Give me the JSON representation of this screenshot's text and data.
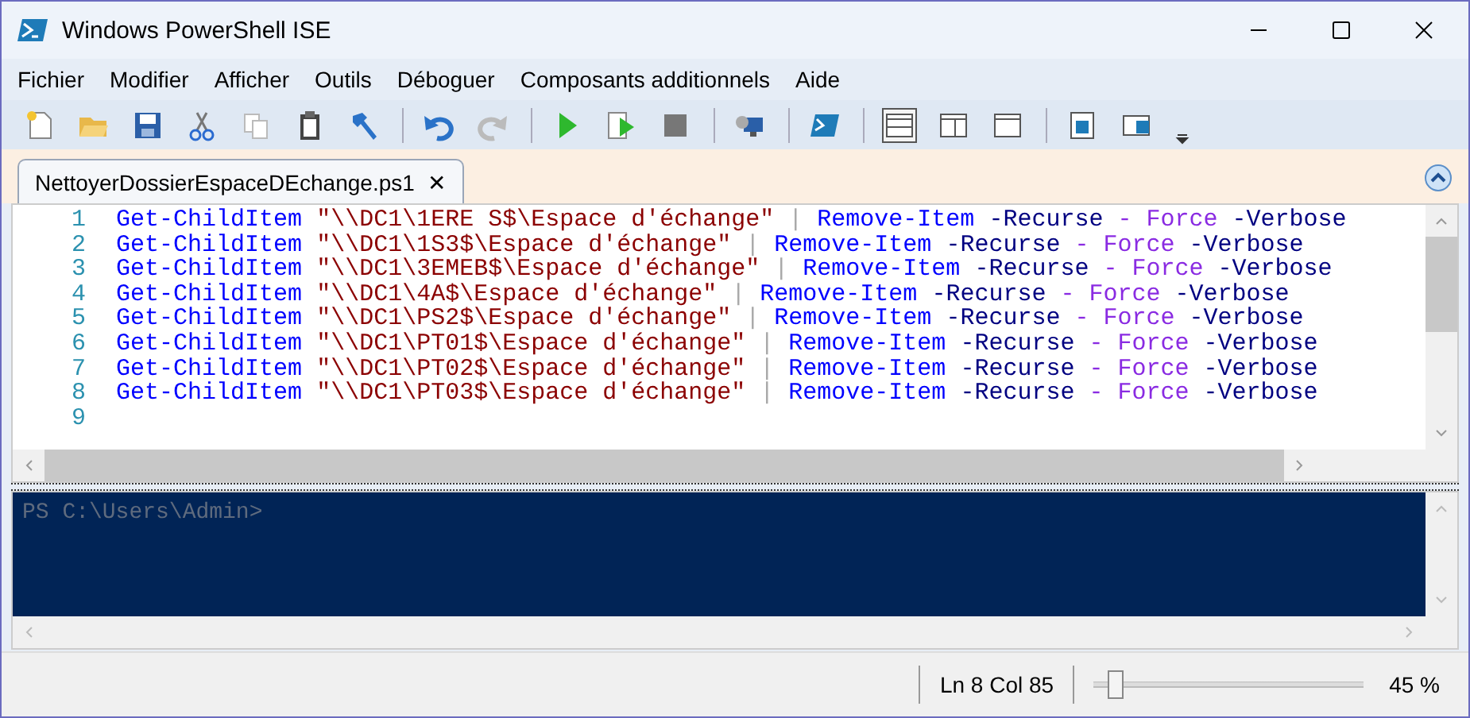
{
  "window": {
    "title": "Windows PowerShell ISE"
  },
  "menu": [
    "Fichier",
    "Modifier",
    "Afficher",
    "Outils",
    "Déboguer",
    "Composants additionnels",
    "Aide"
  ],
  "tabs": [
    {
      "label": "NettoyerDossierEspaceDEchange.ps1",
      "selected": true,
      "close": "✕"
    }
  ],
  "editor": {
    "lines": [
      {
        "number": "1",
        "tokens": [
          {
            "kind": "command",
            "text": "Get-ChildItem"
          },
          {
            "kind": "string",
            "text": "\"\\\\DC1\\1ERE S$\\Espace d'échange\""
          },
          {
            "kind": "pipe",
            "text": "|"
          },
          {
            "kind": "command",
            "text": "Remove-Item"
          },
          {
            "kind": "param",
            "text": "-Recurse"
          },
          {
            "kind": "argument",
            "text": "- Force"
          },
          {
            "kind": "param",
            "text": "-Verbose"
          }
        ]
      },
      {
        "number": "2",
        "tokens": [
          {
            "kind": "command",
            "text": "Get-ChildItem"
          },
          {
            "kind": "string",
            "text": "\"\\\\DC1\\1S3$\\Espace d'échange\""
          },
          {
            "kind": "pipe",
            "text": "|"
          },
          {
            "kind": "command",
            "text": "Remove-Item"
          },
          {
            "kind": "param",
            "text": "-Recurse"
          },
          {
            "kind": "argument",
            "text": "- Force"
          },
          {
            "kind": "param",
            "text": "-Verbose"
          }
        ]
      },
      {
        "number": "3",
        "tokens": [
          {
            "kind": "command",
            "text": "Get-ChildItem"
          },
          {
            "kind": "string",
            "text": "\"\\\\DC1\\3EMEB$\\Espace d'échange\""
          },
          {
            "kind": "pipe",
            "text": "|"
          },
          {
            "kind": "command",
            "text": "Remove-Item"
          },
          {
            "kind": "param",
            "text": "-Recurse"
          },
          {
            "kind": "argument",
            "text": "- Force"
          },
          {
            "kind": "param",
            "text": "-Verbose"
          }
        ]
      },
      {
        "number": "4",
        "tokens": [
          {
            "kind": "command",
            "text": "Get-ChildItem"
          },
          {
            "kind": "string",
            "text": "\"\\\\DC1\\4A$\\Espace d'échange\""
          },
          {
            "kind": "pipe",
            "text": "|"
          },
          {
            "kind": "command",
            "text": "Remove-Item"
          },
          {
            "kind": "param",
            "text": "-Recurse"
          },
          {
            "kind": "argument",
            "text": "- Force"
          },
          {
            "kind": "param",
            "text": "-Verbose"
          }
        ]
      },
      {
        "number": "5",
        "tokens": [
          {
            "kind": "command",
            "text": "Get-ChildItem"
          },
          {
            "kind": "string",
            "text": "\"\\\\DC1\\PS2$\\Espace d'échange\""
          },
          {
            "kind": "pipe",
            "text": "|"
          },
          {
            "kind": "command",
            "text": "Remove-Item"
          },
          {
            "kind": "param",
            "text": "-Recurse"
          },
          {
            "kind": "argument",
            "text": "- Force"
          },
          {
            "kind": "param",
            "text": "-Verbose"
          }
        ]
      },
      {
        "number": "6",
        "tokens": [
          {
            "kind": "command",
            "text": "Get-ChildItem"
          },
          {
            "kind": "string",
            "text": "\"\\\\DC1\\PT01$\\Espace d'échange\""
          },
          {
            "kind": "pipe",
            "text": "|"
          },
          {
            "kind": "command",
            "text": "Remove-Item"
          },
          {
            "kind": "param",
            "text": "-Recurse"
          },
          {
            "kind": "argument",
            "text": "- Force"
          },
          {
            "kind": "param",
            "text": "-Verbose"
          }
        ]
      },
      {
        "number": "7",
        "tokens": [
          {
            "kind": "command",
            "text": "Get-ChildItem"
          },
          {
            "kind": "string",
            "text": "\"\\\\DC1\\PT02$\\Espace d'échange\""
          },
          {
            "kind": "pipe",
            "text": "|"
          },
          {
            "kind": "command",
            "text": "Remove-Item"
          },
          {
            "kind": "param",
            "text": "-Recurse"
          },
          {
            "kind": "argument",
            "text": "- Force"
          },
          {
            "kind": "param",
            "text": "-Verbose"
          }
        ]
      },
      {
        "number": "8",
        "tokens": [
          {
            "kind": "command",
            "text": "Get-ChildItem"
          },
          {
            "kind": "string",
            "text": "\"\\\\DC1\\PT03$\\Espace d'échange\""
          },
          {
            "kind": "pipe",
            "text": "|"
          },
          {
            "kind": "command",
            "text": "Remove-Item"
          },
          {
            "kind": "param",
            "text": "-Recurse"
          },
          {
            "kind": "argument",
            "text": "- Force"
          },
          {
            "kind": "param",
            "text": "-Verbose"
          }
        ]
      },
      {
        "number": "9"
      }
    ]
  },
  "console": {
    "prompt": "PS C:\\Users\\Admin>"
  },
  "status_bar": {
    "position": "Ln 8  Col 85",
    "zoom": {
      "level": 0.05
    },
    "zoom_reading": "45 %"
  }
}
